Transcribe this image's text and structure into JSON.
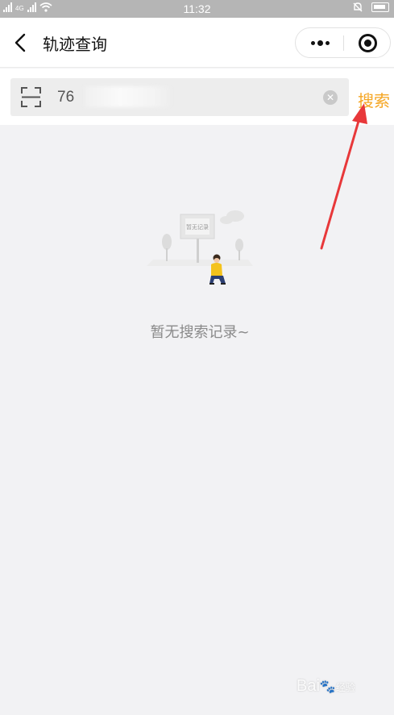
{
  "status_bar": {
    "left": "4G",
    "time": "11:32"
  },
  "nav": {
    "title": "轨迹查询"
  },
  "search": {
    "value": "76",
    "button_label": "搜索"
  },
  "empty_state": {
    "sign_text": "暂无记录",
    "message": "暂无搜索记录~"
  },
  "watermark": {
    "text": "Bai",
    "suffix": "经验"
  },
  "colors": {
    "accent": "#f5a623",
    "background": "#f2f2f4",
    "arrow": "#e8383a"
  }
}
